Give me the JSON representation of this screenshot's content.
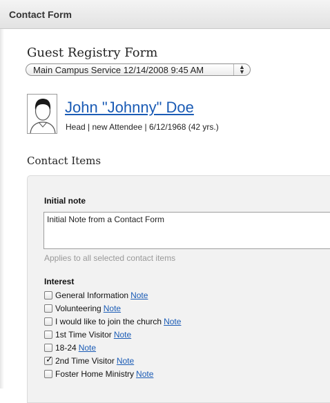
{
  "header": {
    "title": "Contact Form"
  },
  "form": {
    "title": "Guest Registry Form",
    "service_select": {
      "value": "Main Campus Service 12/14/2008 9:45 AM"
    }
  },
  "person": {
    "name": "John \"Johnny\" Doe",
    "details": "Head | new Attendee | 6/12/1968 (42 yrs.)"
  },
  "contact_items": {
    "title": "Contact Items",
    "initial_note_label": "Initial note",
    "initial_note_value": "Initial Note from a Contact Form",
    "hint": "Applies to all selected contact items",
    "interest_label": "Interest",
    "interests": [
      {
        "label": "General Information",
        "note": "Note",
        "checked": false
      },
      {
        "label": "Volunteering",
        "note": "Note",
        "checked": false
      },
      {
        "label": "I would like to join the church",
        "note": "Note",
        "checked": false
      },
      {
        "label": "1st Time Visitor",
        "note": "Note",
        "checked": false
      },
      {
        "label": "18-24",
        "note": "Note",
        "checked": false
      },
      {
        "label": "2nd Time Visitor",
        "note": "Note",
        "checked": true
      },
      {
        "label": "Foster Home Ministry",
        "note": "Note",
        "checked": false
      }
    ]
  },
  "colors": {
    "link": "#1a5bb5",
    "header_bg": "#e6e6e6",
    "panel_bg": "#f2f2f2"
  }
}
